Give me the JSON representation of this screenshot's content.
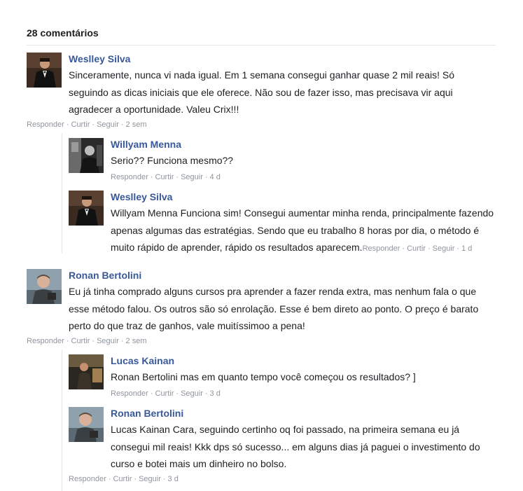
{
  "header": {
    "count_label": "28 comentários"
  },
  "actions": {
    "reply": "Responder",
    "like": "Curtir",
    "follow": "Seguir",
    "separator": "·"
  },
  "threads": [
    {
      "author": "Weslley Silva",
      "lines": [
        "Sinceramente, nunca vi nada igual. Em 1 semana consegui ganhar quase 2 mil reais! Só",
        "seguindo as dicas iniciais que ele oferece. Não sou de fazer isso, mas precisava vir aqui",
        "agradecer a oportunidade. Valeu Crix!!!"
      ],
      "time": "2 sem",
      "replies": [
        {
          "author": "Willyam Menna",
          "lines": [
            "Serio?? Funciona mesmo??"
          ],
          "time": "4 d"
        },
        {
          "author": "Weslley Silva",
          "lines": [
            "Willyam Menna Funciona sim! Consegui aumentar minha renda, principalmente fazendo",
            "apenas algumas das estratégias. Sendo que eu trabalho 8 horas por dia, o método é",
            "muito rápido de aprender, rápido os resultados aparecem."
          ],
          "time": "1 d"
        }
      ]
    },
    {
      "author": "Ronan Bertolini",
      "lines": [
        "Eu já tinha comprado alguns cursos pra aprender a fazer renda extra, mas nenhum fala o que",
        "esse método falou. Os outros são só enrolação. Esse é bem direto ao ponto. O preço é barato",
        "perto do que traz de ganhos, vale muitíssimoo a pena!"
      ],
      "time": "2 sem",
      "replies": [
        {
          "author": "Lucas Kainan",
          "lines": [
            "Ronan Bertolini mas em quanto tempo você começou os resultados? ]"
          ],
          "time": "3 d"
        },
        {
          "author": "Ronan Bertolini",
          "lines": [
            "Lucas Kainan Cara, seguindo certinho oq foi passado, na primeira semana eu já",
            "consegui mil reais! Kkk dps só sucesso... em alguns dias já paguei o investimento do",
            "curso e botei mais um dinheiro no bolso."
          ],
          "time": "3 d"
        }
      ]
    }
  ],
  "colors": {
    "author_link": "#385898",
    "body_text": "#1c1e21",
    "meta_text": "#90949c",
    "divider": "#e5e6e9"
  }
}
